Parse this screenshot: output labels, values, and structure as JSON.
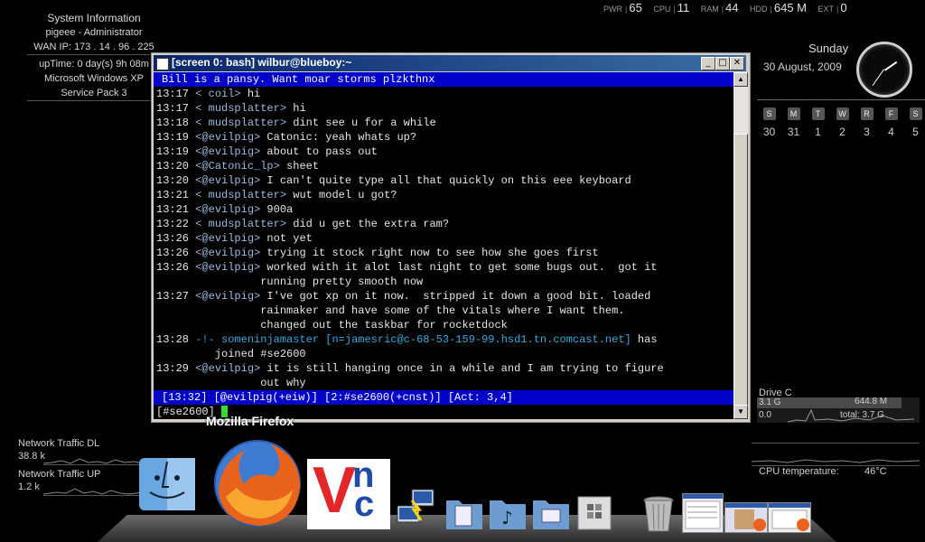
{
  "sysinfo": {
    "title": "System Information",
    "user": "pigeee - Administrator",
    "wan_ip": "WAN IP: 173 . 14 . 96 . 225",
    "uptime": "upTime: 0 day(s) 9h 08m",
    "os": "Microsoft Windows XP",
    "sp": "Service Pack 3"
  },
  "stats": {
    "pwr_label": "PWR",
    "pwr": "65",
    "cpu_label": "CPU",
    "cpu": "11",
    "ram_label": "RAM",
    "ram": "44",
    "hdd_label": "HDD",
    "hdd": "645 M",
    "ext_label": "EXT",
    "ext": "0"
  },
  "clock": {
    "day": "Sunday",
    "date": "30 August, 2009"
  },
  "calendar": {
    "headers": [
      "S",
      "M",
      "T",
      "W",
      "R",
      "F",
      "S"
    ],
    "days": [
      "30",
      "31",
      "1",
      "2",
      "3",
      "4",
      "5"
    ]
  },
  "window": {
    "title": "[screen 0: bash] wilbur@blueboy:~",
    "minimize": "_",
    "maximize": "□",
    "close": "✕"
  },
  "terminal": {
    "topic": "Bill is a pansy. Want moar storms plzkthnx",
    "lines": [
      {
        "t": "13:17",
        "n": " < coil>",
        "m": " hi"
      },
      {
        "t": "13:17",
        "n": " < mudsplatter>",
        "m": " hi"
      },
      {
        "t": "13:18",
        "n": " < mudsplatter>",
        "m": " dint see u for a while"
      },
      {
        "t": "13:19",
        "n": " <@evilpig>",
        "m": " Catonic: yeah whats up?"
      },
      {
        "t": "13:19",
        "n": " <@evilpig>",
        "m": " about to pass out"
      },
      {
        "t": "13:20",
        "n": " <@Catonic_lp>",
        "m": " sheet"
      },
      {
        "t": "13:20",
        "n": " <@evilpig>",
        "m": " I can't quite type all that quickly on this eee keyboard"
      },
      {
        "t": "13:21",
        "n": " < mudsplatter>",
        "m": " wut model u got?"
      },
      {
        "t": "13:21",
        "n": " <@evilpig>",
        "m": " 900a"
      },
      {
        "t": "13:22",
        "n": " < mudsplatter>",
        "m": " did u get the extra ram?"
      },
      {
        "t": "13:26",
        "n": " <@evilpig>",
        "m": " not yet"
      },
      {
        "t": "13:26",
        "n": " <@evilpig>",
        "m": " trying it stock right now to see how she goes first"
      },
      {
        "t": "13:26",
        "n": " <@evilpig>",
        "m": " worked with it alot last night to get some bugs out.  got it"
      },
      {
        "t": "",
        "n": "",
        "m": "                running pretty smooth now"
      },
      {
        "t": "13:27",
        "n": " <@evilpig>",
        "m": " I've got xp on it now.  stripped it down a good bit. loaded"
      },
      {
        "t": "",
        "n": "",
        "m": "                rainmaker and have some of the vitals where I want them."
      },
      {
        "t": "",
        "n": "",
        "m": "                changed out the taskbar for rocketdock"
      }
    ],
    "join_time": "13:28",
    "join_prefix": " -!- ",
    "join_nick": "someninjamaster",
    "join_host": " [n=jamesric@c-68-53-159-99.hsd1.tn.comcast.net]",
    "join_has": " has",
    "join_cont": "         joined #se2600",
    "last_lines": [
      {
        "t": "13:29",
        "n": " <@evilpig>",
        "m": " it is still hanging once in a while and I am trying to figure"
      },
      {
        "t": "",
        "n": "",
        "m": "                out why"
      }
    ],
    "status": "[13:32] [@evilpig(+eiw)] [2:#se2600(+cnst)] [Act: 3,4]",
    "prompt": "[#se2600] "
  },
  "tooltip": "Mozilla Firefox",
  "network": {
    "dl_label": "Network Traffic DL",
    "dl_value": "38.8 k",
    "ul_label": "Network Traffic UP",
    "ul_value": "1.2 k"
  },
  "drive": {
    "label": "Drive C",
    "used": "644.8 M",
    "free": "3.1 G",
    "zero": "0.0",
    "total": "total: 3.7 G"
  },
  "cpu_temp": {
    "label": "CPU temperature:",
    "value": "46°C"
  },
  "dock": {
    "items": [
      "finder-icon",
      "firefox-icon",
      "vnc-icon",
      "network-icon",
      "documents-folder-icon",
      "music-folder-icon",
      "pictures-folder-icon",
      "windows-folder-icon",
      "trash-icon",
      "window-thumb-1",
      "window-thumb-2",
      "window-thumb-3"
    ],
    "vnc_v": "V",
    "vnc_n": "n",
    "vnc_c": "c"
  }
}
